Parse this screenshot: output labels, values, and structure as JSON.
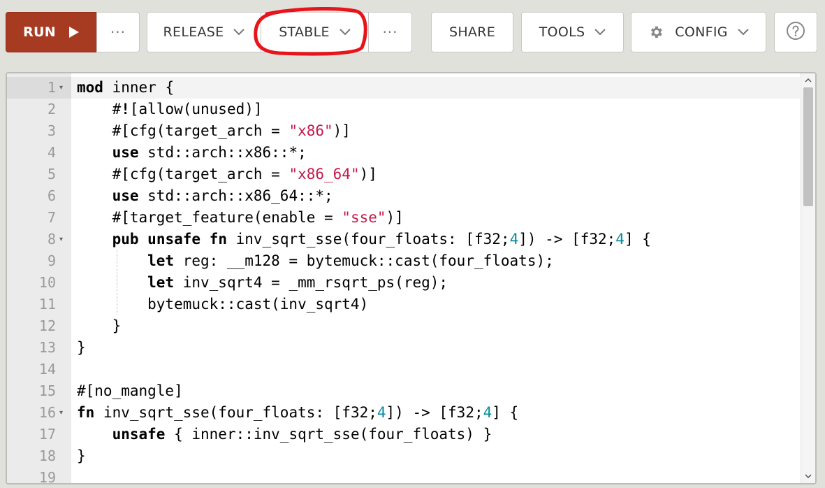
{
  "toolbar": {
    "run_label": "RUN",
    "more_label": "···",
    "mode_label": "RELEASE",
    "channel_label": "STABLE",
    "share_label": "SHARE",
    "tools_label": "TOOLS",
    "config_label": "CONFIG",
    "help_icon": "help-circle-icon",
    "config_icon": "gear-icon",
    "run_icon": "play-icon",
    "dropdown_icon": "chevron-down-icon"
  },
  "colors": {
    "run_button": "#a73b22",
    "annotation": "#e8141c",
    "string": "#c41a4a",
    "number": "#098c9a"
  },
  "editor": {
    "language": "rust",
    "active_line": 1,
    "line_numbers": [
      "1",
      "2",
      "3",
      "4",
      "5",
      "6",
      "7",
      "8",
      "9",
      "10",
      "11",
      "12",
      "13",
      "14",
      "15",
      "16",
      "17",
      "18",
      "19"
    ],
    "foldable_lines": [
      1,
      8,
      16
    ],
    "lines": [
      "mod inner {",
      "    #![allow(unused)]",
      "    #[cfg(target_arch = \"x86\")]",
      "    use std::arch::x86::*;",
      "    #[cfg(target_arch = \"x86_64\")]",
      "    use std::arch::x86_64::*;",
      "    #[target_feature(enable = \"sse\")]",
      "    pub unsafe fn inv_sqrt_sse(four_floats: [f32;4]) -> [f32;4] {",
      "        let reg: __m128 = bytemuck::cast(four_floats);",
      "        let inv_sqrt4 = _mm_rsqrt_ps(reg);",
      "        bytemuck::cast(inv_sqrt4)",
      "    }",
      "}",
      "",
      "#[no_mangle]",
      "fn inv_sqrt_sse(four_floats: [f32;4]) -> [f32;4] {",
      "    unsafe { inner::inv_sqrt_sse(four_floats) }",
      "}",
      ""
    ]
  }
}
